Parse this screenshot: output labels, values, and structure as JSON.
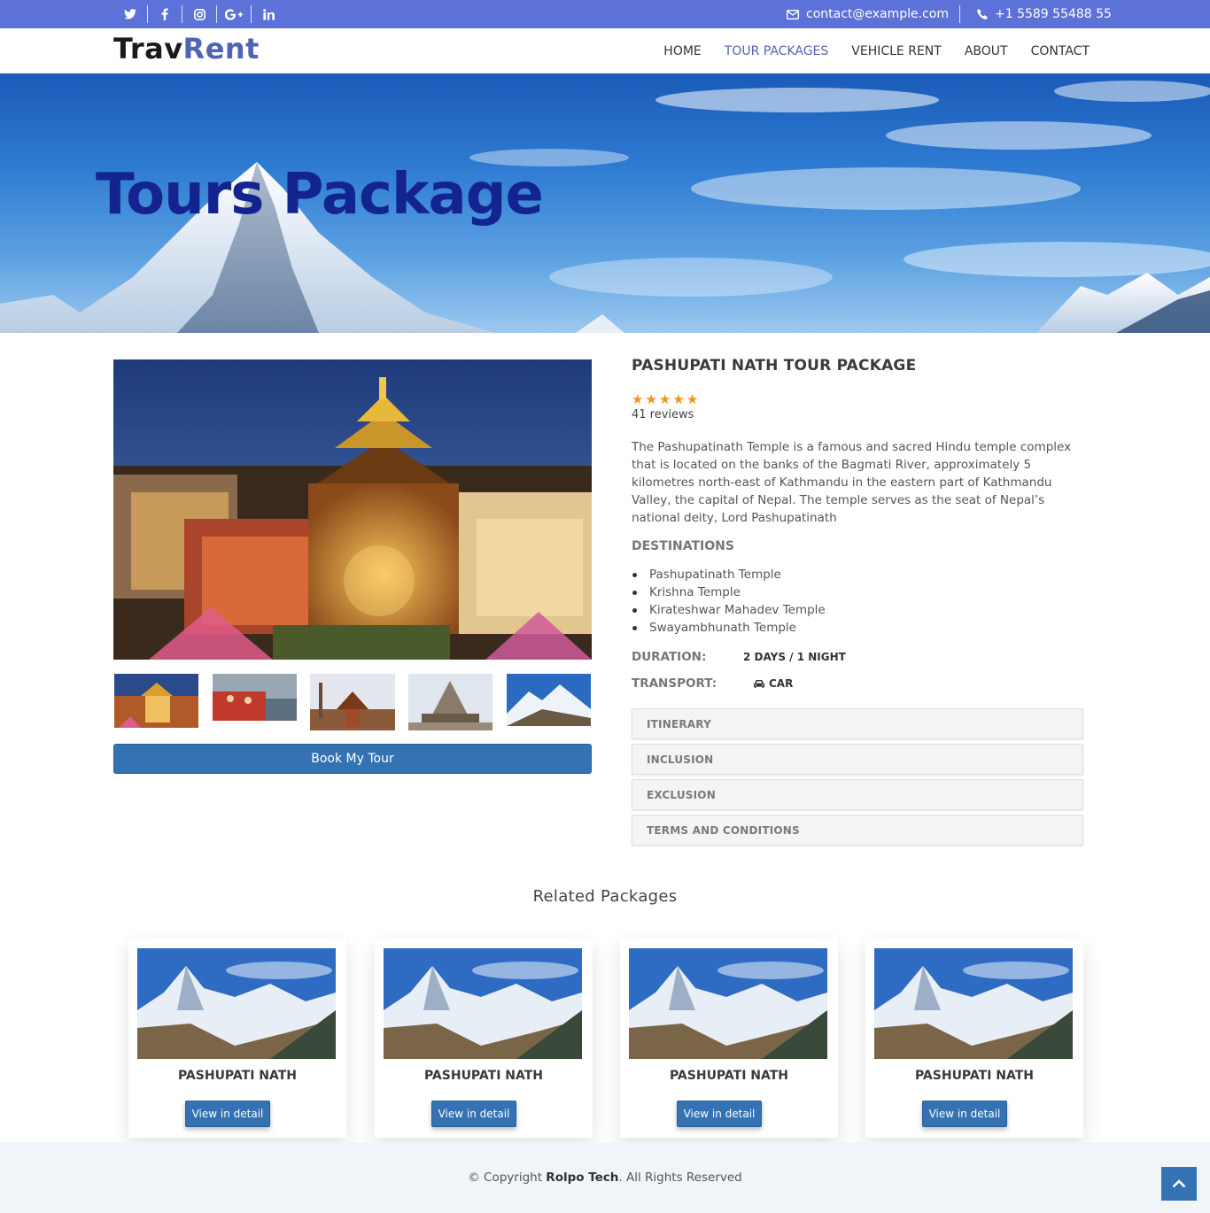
{
  "topbar": {
    "social": [
      {
        "name": "twitter-icon",
        "glyph": "🐦"
      },
      {
        "name": "facebook-icon",
        "glyph": "f"
      },
      {
        "name": "instagram-icon",
        "glyph": "◎"
      },
      {
        "name": "google-plus-icon",
        "glyph": "G+"
      },
      {
        "name": "linkedin-icon",
        "glyph": "in"
      }
    ],
    "email": "contact@example.com",
    "phone": "+1 5589 55488 55",
    "bar_color": "#5c72d8"
  },
  "header": {
    "logo_part1": "Trav",
    "logo_part2": "Rent",
    "nav": [
      {
        "label": "HOME",
        "active": false
      },
      {
        "label": "TOUR PACKAGES",
        "active": true
      },
      {
        "label": "VEHICLE RENT",
        "active": false
      },
      {
        "label": "ABOUT",
        "active": false
      },
      {
        "label": "CONTACT",
        "active": false
      }
    ]
  },
  "hero": {
    "title": "Tours Package"
  },
  "package": {
    "title": "PASHUPATI NATH TOUR PACKAGE",
    "rating": 5,
    "reviews": "41 reviews",
    "description": "The Pashupatinath Temple is a famous and sacred Hindu temple complex that is located on the banks of the Bagmati River, approximately 5 kilometres north-east of Kathmandu in the eastern part of Kathmandu Valley, the capital of Nepal. The temple serves as the seat of Nepal’s national deity, Lord Pashupatinath",
    "destinations_heading": "DESTINATIONS",
    "destinations": [
      "Pashupatinath Temple",
      "Krishna Temple",
      "Kirateshwar Mahadev Temple",
      "Swayambhunath Temple"
    ],
    "duration_label": "DURATION:",
    "duration": "2 DAYS / 1 NIGHT",
    "transport_label": "TRANSPORT:",
    "transport": "CAR",
    "book_button": "Book My Tour",
    "accordion": [
      "ITINERARY",
      "INCLUSION",
      "EXCLUSION",
      "TERMS AND CONDITIONS"
    ]
  },
  "related": {
    "title": "Related Packages",
    "cards": [
      {
        "title": "PASHUPATI NATH",
        "button": "View in detail"
      },
      {
        "title": "PASHUPATI NATH",
        "button": "View in detail"
      },
      {
        "title": "PASHUPATI NATH",
        "button": "View in detail"
      },
      {
        "title": "PASHUPATI NATH",
        "button": "View in detail"
      }
    ]
  },
  "footer": {
    "prefix": "© Copyright ",
    "company": "Rolpo Tech",
    "suffix": ". All Rights Reserved"
  },
  "colors": {
    "primary": "#3472b4",
    "accent": "#5164b3",
    "star": "#f6911e"
  }
}
